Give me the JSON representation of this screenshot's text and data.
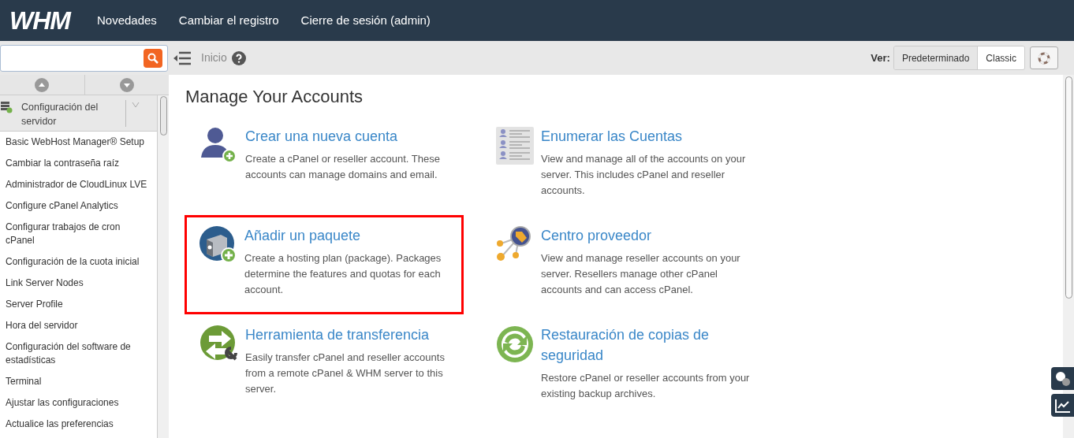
{
  "top_nav": {
    "logo": "WHM",
    "links": [
      "Novedades",
      "Cambiar el registro",
      "Cierre de sesión (admin)"
    ]
  },
  "toolbar": {
    "breadcrumb": "Inicio",
    "view_label": "Ver:",
    "view_options": [
      {
        "label": "Predeterminado",
        "selected": true
      },
      {
        "label": "Classic",
        "selected": false
      }
    ]
  },
  "sidebar": {
    "section": {
      "title": "Configuración del servidor",
      "expanded": true
    },
    "items": [
      "Basic WebHost Manager® Setup",
      "Cambiar la contraseña raíz",
      "Administrador de CloudLinux LVE",
      "Configure cPanel Analytics",
      "Configurar trabajos de cron cPanel",
      "Configuración de la cuota inicial",
      "Link Server Nodes",
      "Server Profile",
      "Hora del servidor",
      "Configuración del software de estadísticas",
      "Terminal",
      "Ajustar las configuraciones",
      "Actualice las preferencias"
    ]
  },
  "main": {
    "heading": "Manage Your Accounts",
    "tiles": [
      {
        "kind": "add-user",
        "title": "Crear una nueva cuenta",
        "description": "Create a cPanel or reseller account. These accounts can manage domains and email.",
        "highlighted": false
      },
      {
        "kind": "list",
        "title": "Enumerar las Cuentas",
        "description": "View and manage all of the accounts on your server. This includes cPanel and reseller accounts.",
        "highlighted": false
      },
      {
        "kind": "package",
        "title": "Añadir un paquete",
        "description": "Create a hosting plan (package). Packages determine the features and quotas for each account.",
        "highlighted": true
      },
      {
        "kind": "reseller",
        "title": "Centro proveedor",
        "description": "View and manage reseller accounts on your server. Resellers manage other cPanel accounts and can access cPanel.",
        "highlighted": false
      },
      {
        "kind": "transfer",
        "title": "Herramienta de transferencia",
        "description": "Easily transfer cPanel and reseller accounts from a remote cPanel & WHM server to this server.",
        "highlighted": false
      },
      {
        "kind": "restore",
        "title": "Restauración de copias de seguridad",
        "description": "Restore cPanel or reseller accounts from your existing backup archives.",
        "highlighted": false
      }
    ]
  }
}
